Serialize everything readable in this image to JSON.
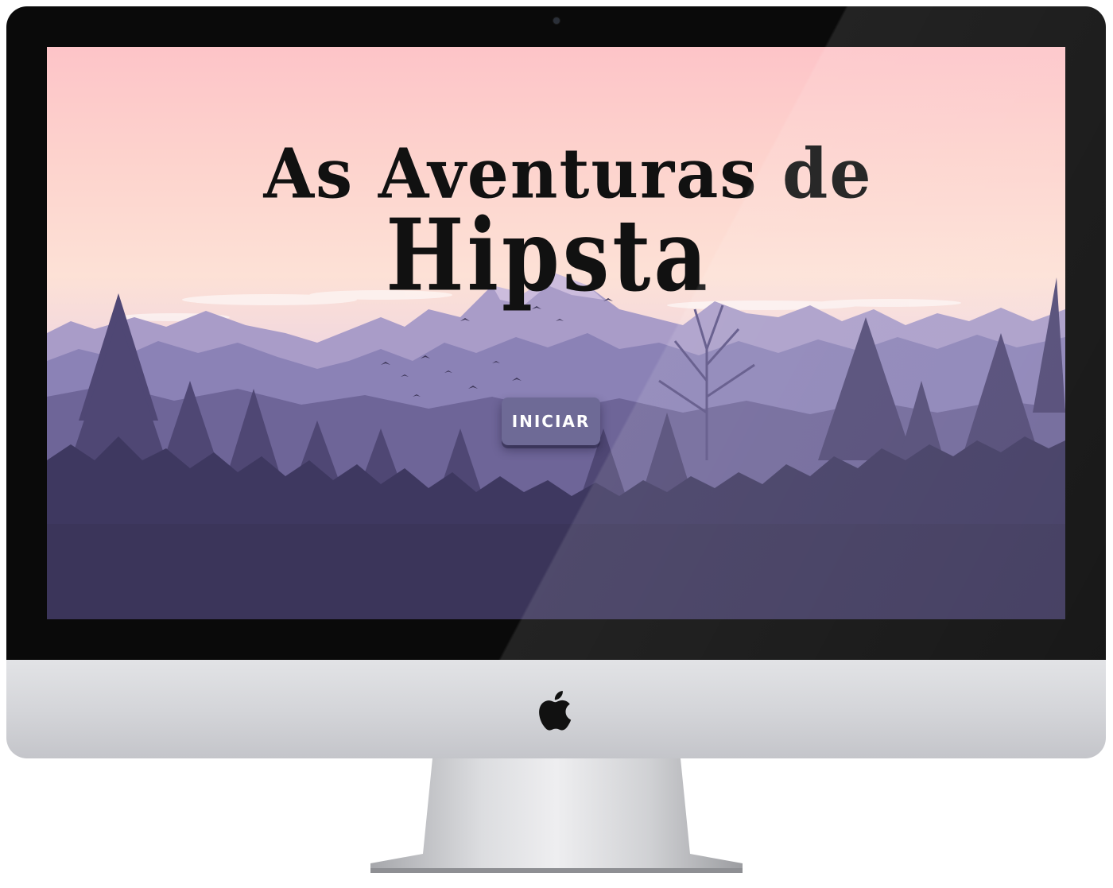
{
  "app": {
    "title_line1": "As Aventuras de",
    "title_line2": "Hipsta",
    "start_label": "INICIAR"
  },
  "device": {
    "logo_icon": "apple-logo-icon"
  },
  "colors": {
    "button": "#6e6a96",
    "sky_top": "#fdc4c8",
    "forest_dark": "#4e4670"
  }
}
